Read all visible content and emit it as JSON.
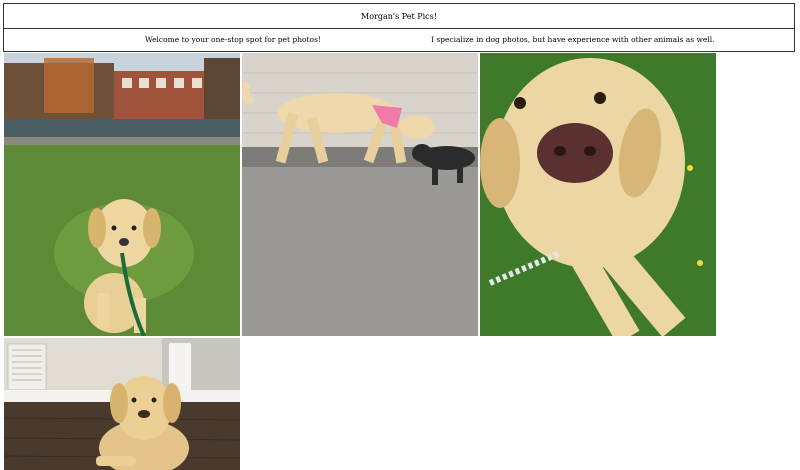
{
  "header": {
    "title": "Morgan's Pet Pics!"
  },
  "intro": {
    "welcome": "Welcome to your one-stop spot for pet photos!",
    "specialty": "I specialize in dog photos, but have experience with other animals as well."
  },
  "gallery": {
    "photos": [
      {
        "subject": "yellow lab puppy sitting on grass with green leash by pond"
      },
      {
        "subject": "yellow lab with pink bandana playing with black puppy"
      },
      {
        "subject": "close-up of yellow lab nose lying in grass"
      },
      {
        "subject": "yellow lab puppy lying on wood floor indoors"
      }
    ]
  }
}
